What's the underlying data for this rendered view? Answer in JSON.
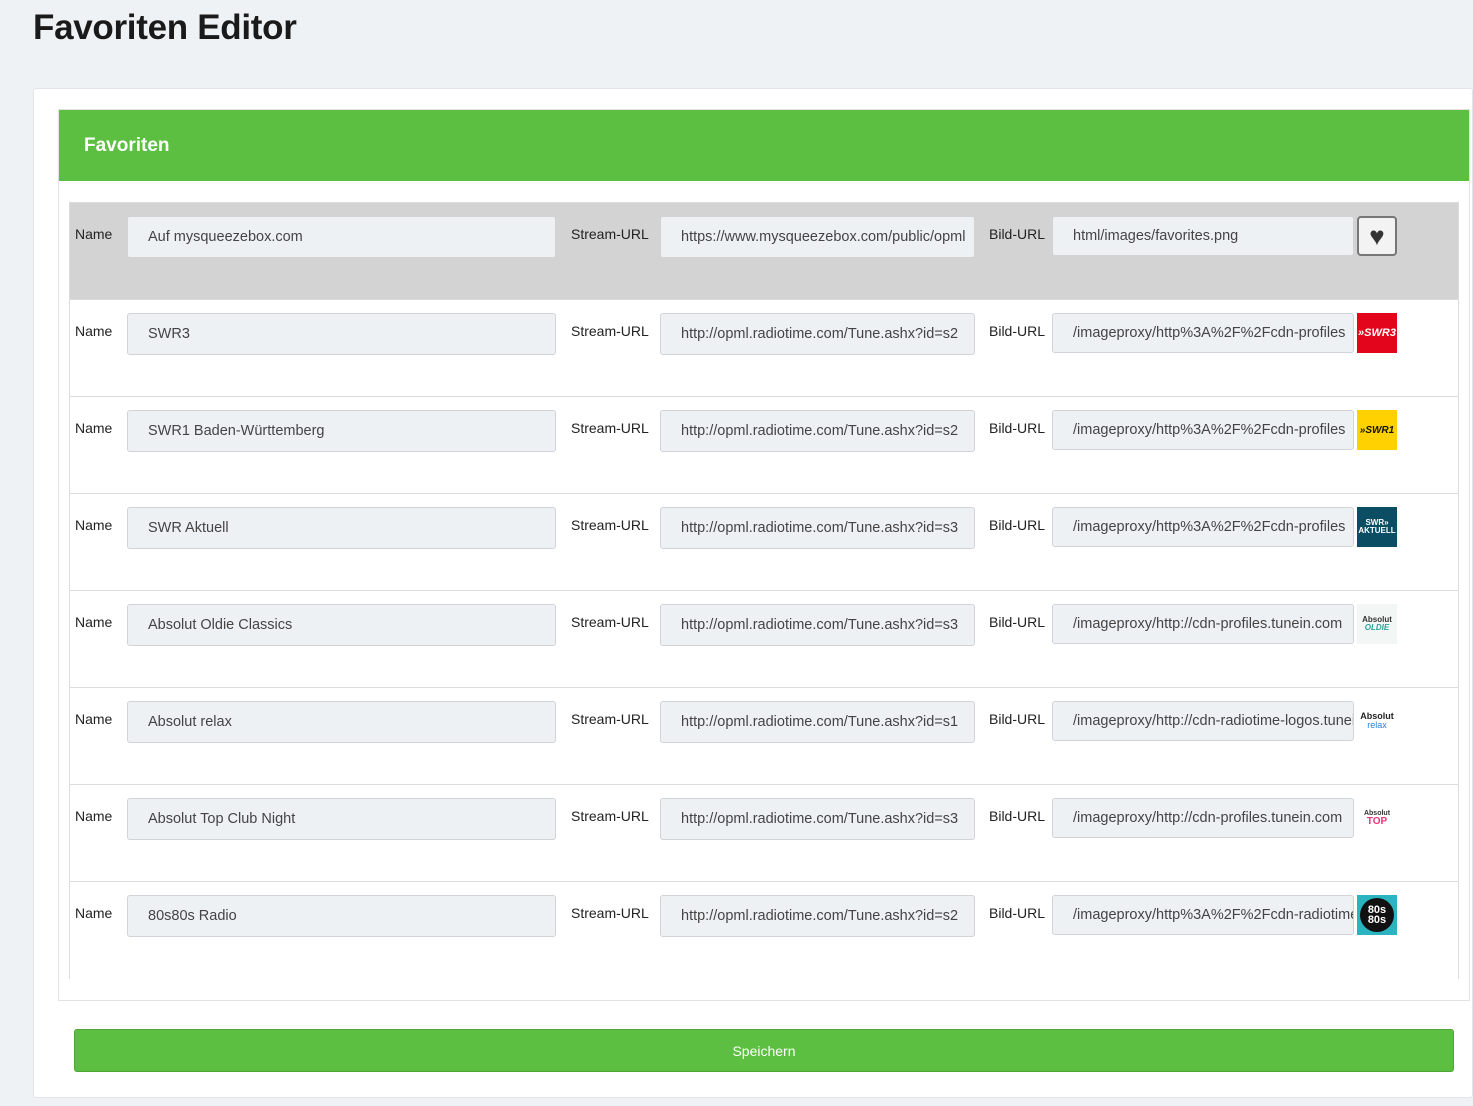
{
  "page": {
    "title": "Favoriten Editor"
  },
  "panel": {
    "header": "Favoriten"
  },
  "labels": {
    "name": "Name",
    "stream": "Stream-URL",
    "bild": "Bild-URL"
  },
  "favorites": [
    {
      "name": "Auf mysqueezebox.com",
      "stream": "https://www.mysqueezebox.com/public/opml",
      "bild": "html/images/favorites.png",
      "icon": "heart-icon",
      "logo_text": [
        "♥"
      ]
    },
    {
      "name": "SWR3",
      "stream": "http://opml.radiotime.com/Tune.ashx?id=s2",
      "bild": "/imageproxy/http%3A%2F%2Fcdn-profiles",
      "icon": "swr3-logo-icon",
      "logo_text": [
        "»SWR3"
      ]
    },
    {
      "name": "SWR1 Baden-Württemberg",
      "stream": "http://opml.radiotime.com/Tune.ashx?id=s2",
      "bild": "/imageproxy/http%3A%2F%2Fcdn-profiles",
      "icon": "swr1-logo-icon",
      "logo_text": [
        "»SWR1"
      ]
    },
    {
      "name": "SWR Aktuell",
      "stream": "http://opml.radiotime.com/Tune.ashx?id=s3",
      "bild": "/imageproxy/http%3A%2F%2Fcdn-profiles",
      "icon": "swr-aktuell-logo-icon",
      "logo_text": [
        "SWR»",
        "AKTUELL"
      ]
    },
    {
      "name": "Absolut Oldie Classics",
      "stream": "http://opml.radiotime.com/Tune.ashx?id=s3",
      "bild": "/imageproxy/http://cdn-profiles.tunein.com",
      "icon": "absolut-oldie-logo-icon",
      "logo_text": [
        "Absolut",
        "OLDIE"
      ]
    },
    {
      "name": "Absolut relax",
      "stream": "http://opml.radiotime.com/Tune.ashx?id=s1",
      "bild": "/imageproxy/http://cdn-radiotime-logos.tunein",
      "icon": "absolut-relax-logo-icon",
      "logo_text": [
        "Absolut",
        "relax"
      ]
    },
    {
      "name": "Absolut Top Club Night",
      "stream": "http://opml.radiotime.com/Tune.ashx?id=s3",
      "bild": "/imageproxy/http://cdn-profiles.tunein.com",
      "icon": "absolut-top-logo-icon",
      "logo_text": [
        "Absolut",
        "TOP"
      ]
    },
    {
      "name": "80s80s Radio",
      "stream": "http://opml.radiotime.com/Tune.ashx?id=s2",
      "bild": "/imageproxy/http%3A%2F%2Fcdn-radiotime",
      "icon": "80s80s-logo-icon",
      "logo_text": [
        "80s",
        "80s"
      ]
    }
  ],
  "actions": {
    "save": "Speichern"
  },
  "colors": {
    "accent": "#5dbf41",
    "active_row": "#d3d3d3",
    "page_bg": "#eff2f5"
  }
}
